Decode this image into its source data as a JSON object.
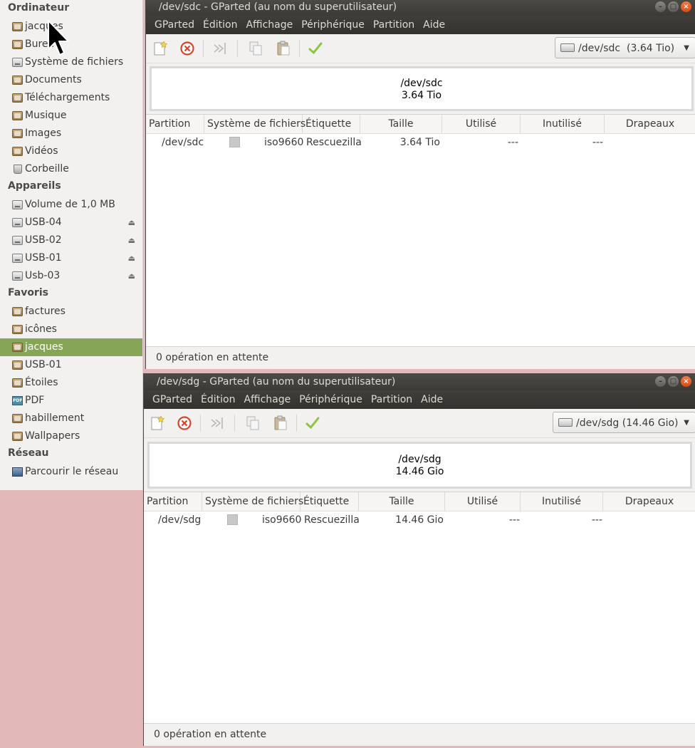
{
  "sidebar": {
    "sections": [
      {
        "header": "Ordinateur",
        "items": [
          {
            "label": "jacques",
            "icon": "home-folder-icon"
          },
          {
            "label": "Bureau",
            "icon": "desktop-folder-icon"
          },
          {
            "label": "Système de fichiers",
            "icon": "drive-icon"
          },
          {
            "label": "Documents",
            "icon": "documents-folder-icon"
          },
          {
            "label": "Téléchargements",
            "icon": "downloads-folder-icon"
          },
          {
            "label": "Musique",
            "icon": "music-folder-icon"
          },
          {
            "label": "Images",
            "icon": "pictures-folder-icon"
          },
          {
            "label": "Vidéos",
            "icon": "videos-folder-icon"
          },
          {
            "label": "Corbeille",
            "icon": "trash-icon"
          }
        ]
      },
      {
        "header": "Appareils",
        "items": [
          {
            "label": "Volume de 1,0 MB",
            "icon": "drive-icon",
            "eject": false
          },
          {
            "label": "USB-04",
            "icon": "drive-icon",
            "eject": true
          },
          {
            "label": "USB-02",
            "icon": "drive-icon",
            "eject": true
          },
          {
            "label": "USB-01",
            "icon": "drive-icon",
            "eject": true
          },
          {
            "label": "Usb-03",
            "icon": "drive-icon",
            "eject": true
          }
        ]
      },
      {
        "header": "Favoris",
        "items": [
          {
            "label": "factures",
            "icon": "folder-icon"
          },
          {
            "label": "icônes",
            "icon": "folder-icon"
          },
          {
            "label": "jacques",
            "icon": "home-folder-icon",
            "selected": true
          },
          {
            "label": "USB-01",
            "icon": "folder-icon"
          },
          {
            "label": "Étoiles",
            "icon": "folder-icon"
          },
          {
            "label": "PDF",
            "icon": "pdf-icon"
          },
          {
            "label": "habillement",
            "icon": "folder-icon"
          },
          {
            "label": "Wallpapers",
            "icon": "folder-icon"
          }
        ]
      },
      {
        "header": "Réseau",
        "items": [
          {
            "label": "Parcourir le réseau",
            "icon": "network-icon"
          }
        ]
      }
    ]
  },
  "menu": [
    "GParted",
    "Édition",
    "Affichage",
    "Périphérique",
    "Partition",
    "Aide"
  ],
  "columns": [
    "Partition",
    "Système de fichiers",
    "Étiquette",
    "Taille",
    "Utilisé",
    "Inutilisé",
    "Drapeaux"
  ],
  "window1": {
    "title": "/dev/sdc - GParted (au nom du superutilisateur)",
    "device_combo": "/dev/sdc  (3.64 Tio)",
    "disk_name": "/dev/sdc",
    "disk_size": "3.64 Tio",
    "row": {
      "partition": "/dev/sdc",
      "filesystem": "iso9660",
      "label": "Rescuezilla",
      "size": "3.64 Tio",
      "used": "---",
      "unused": "---",
      "flags": ""
    },
    "status": "0 opération en attente"
  },
  "window2": {
    "title": "/dev/sdg - GParted (au nom du superutilisateur)",
    "device_combo": "/dev/sdg (14.46 Gio)",
    "disk_name": "/dev/sdg",
    "disk_size": "14.46 Gio",
    "row": {
      "partition": "/dev/sdg",
      "filesystem": "iso9660",
      "label": "Rescuezilla",
      "size": "14.46 Gio",
      "used": "---",
      "unused": "---",
      "flags": ""
    },
    "status": "0 opération en attente"
  },
  "colors": {
    "selected_bg": "#87a556",
    "titlebar_bg": "#3b3a36",
    "close_button": "#df4a12",
    "desktop_bg": "#e2b9b8"
  }
}
